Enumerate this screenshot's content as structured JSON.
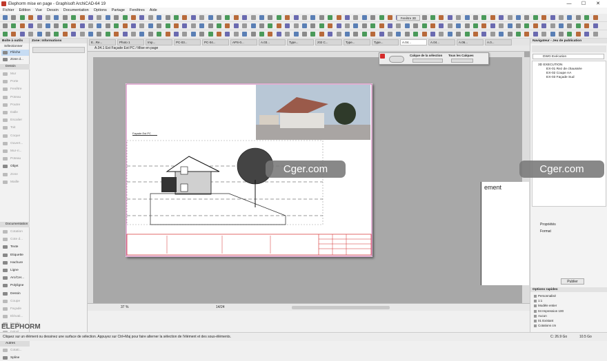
{
  "window": {
    "title": "Elephorm mise en page - Graphisoft ArchiCAD-64 19",
    "minimize": "—",
    "maximize": "☐",
    "close": "✕"
  },
  "menu": [
    "Fichier",
    "Edition",
    "Vue",
    "Dessin",
    "Documentation",
    "Options",
    "Partage",
    "Fenêtres",
    "Aide"
  ],
  "toolbar": {
    "fenetre3d": "Fenêtre 3D"
  },
  "tabs": [
    "E...Re...",
    "Photo 1",
    "Imp...",
    "PC-03...",
    "PC-04...",
    "APS-0...",
    "A.03...",
    "Type...",
    "z02 C...",
    "Type...",
    "Type...",
    "A.04...",
    "A.04...",
    "A.06...",
    "A.0..."
  ],
  "toolbox": {
    "header": "Boîte à outils",
    "selection_label": "Sélectionner",
    "arrow": "Flèche",
    "zone": "Zone d...",
    "dessin_section": "Dessin",
    "documentation_section": "Documentation",
    "autres_section": "Autres",
    "tools": [
      {
        "label": "Mur",
        "off": true
      },
      {
        "label": "Porte",
        "off": true
      },
      {
        "label": "Fenêtre",
        "off": true
      },
      {
        "label": "Poteau",
        "off": true
      },
      {
        "label": "Poutre",
        "off": true
      },
      {
        "label": "Dalle",
        "off": true
      },
      {
        "label": "Escalier",
        "off": true
      },
      {
        "label": "Toit",
        "off": true
      },
      {
        "label": "Coque",
        "off": true
      },
      {
        "label": "Ouvert...",
        "off": true
      },
      {
        "label": "Mur-ri...",
        "off": true
      },
      {
        "label": "Poteau",
        "off": true
      },
      {
        "label": "Objet",
        "off": false
      },
      {
        "label": "Zone",
        "off": true
      },
      {
        "label": "Maille",
        "off": true
      }
    ],
    "doc_tools": [
      {
        "label": "Cotation",
        "off": true
      },
      {
        "label": "Cote d...",
        "off": true
      },
      {
        "label": "Texte",
        "off": false
      },
      {
        "label": "Etiquette",
        "off": false
      },
      {
        "label": "Hachure",
        "off": false
      },
      {
        "label": "Ligne",
        "off": false
      },
      {
        "label": "Arc/Cer...",
        "off": false
      },
      {
        "label": "Polyligne",
        "off": false
      },
      {
        "label": "Dessin",
        "off": false
      },
      {
        "label": "Coupe",
        "off": true
      },
      {
        "label": "Façade",
        "off": true
      },
      {
        "label": "Elévati...",
        "off": true
      },
      {
        "label": "Feuille ...",
        "off": true
      },
      {
        "label": "Détail",
        "off": true
      },
      {
        "label": "Change...",
        "off": false
      }
    ],
    "other_tools": [
      {
        "label": "Cotati...",
        "off": true
      },
      {
        "label": "Spline",
        "off": false
      }
    ]
  },
  "infobox": {
    "header": "Zone: Informations"
  },
  "viewport": {
    "title": "A.04.1 Est Façade Est PC / Mise en page",
    "drawing_title": "Façade Est PC",
    "zoom": "37 %",
    "page": "14/24"
  },
  "palette": {
    "sel_layer": "Calque de la sélection",
    "all_layers": "Tous les Calques"
  },
  "navigator": {
    "header": "Navigateur - Jeu de publication",
    "set": "DWG Exécution",
    "folder": "3D EXECUTION",
    "items": [
      "EX-01 Rez de chaussée",
      "EX-02 Coupe AA",
      "EX-03 Façade Sud"
    ],
    "props": "Propriétés",
    "format": "Format",
    "publish": "Publier",
    "cut_text": "ement"
  },
  "quickopts": {
    "header": "Options rapides",
    "items": [
      "Personnalisé",
      "1:1",
      "Modèle entier",
      "04 Impression 100",
      "Aucun",
      "01 Existant",
      "Cotations cm"
    ]
  },
  "status": {
    "hint": "Cliquez sur un élément ou dessinez une surface de sélection. Appuyez sur Ctrl+Maj pour faire alterner la sélection de l'élément et des sous-éléments.",
    "disk1": "C: 26.9 Go",
    "disk2": "10.5 Go"
  },
  "watermark": "Cger.com",
  "brand": "ELEPHORM",
  "colors": {
    "magenta": "#b0388f",
    "red": "#d42a2a",
    "select": "#c6dcf3"
  }
}
